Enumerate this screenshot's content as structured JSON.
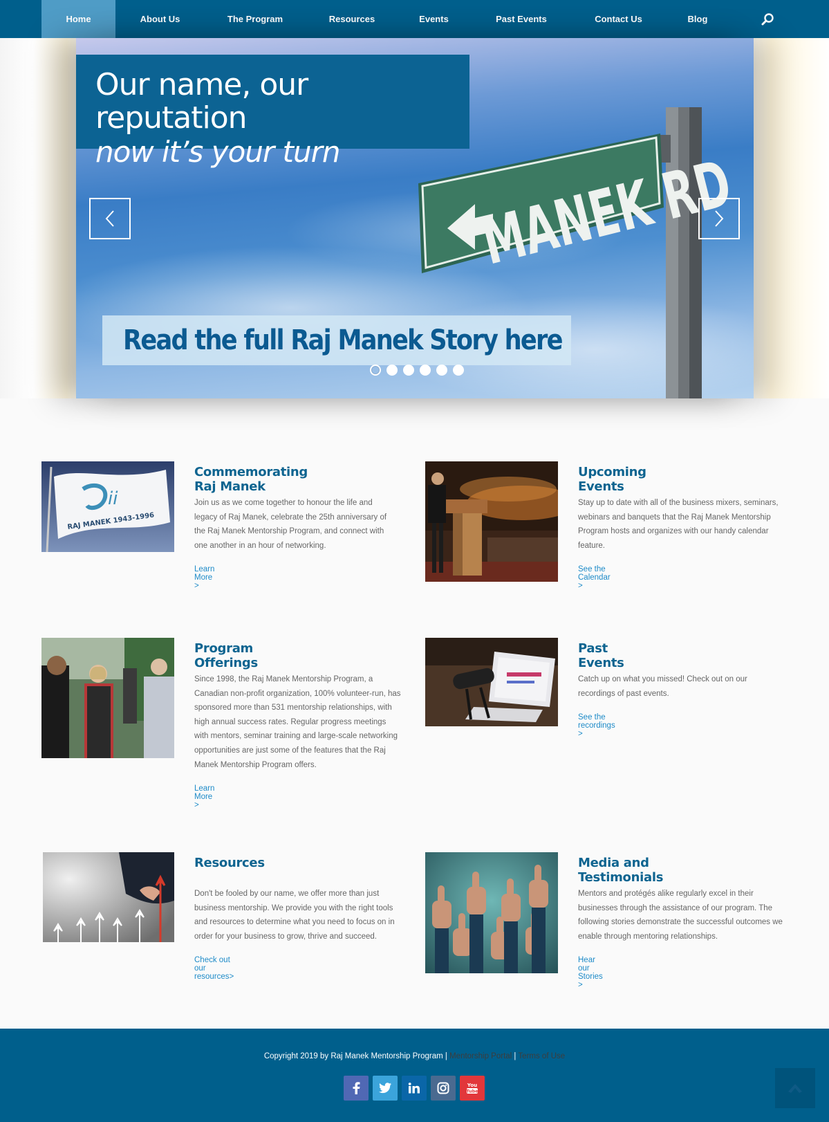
{
  "nav": {
    "items": [
      {
        "label": "Home",
        "active": true
      },
      {
        "label": "About Us"
      },
      {
        "label": "The Program"
      },
      {
        "label": "Resources"
      },
      {
        "label": "Events"
      },
      {
        "label": "Past Events"
      },
      {
        "label": "Contact Us"
      },
      {
        "label": "Blog"
      }
    ],
    "search_icon": "search-icon"
  },
  "hero": {
    "headline_1": "Our name, our reputation",
    "headline_2": "now it’s your turn",
    "sign_text": "MANEK RD",
    "cta": "Read the full Raj Manek Story here",
    "slides_total": 6,
    "active_slide": 1
  },
  "features": [
    {
      "title": "Commemorating Raj Manek",
      "body": "Join us as we come together to honour the life and legacy of Raj Manek, celebrate the 25th anniversary of the Raj Manek Mentorship Program, and connect with one another in an hour of networking.",
      "link": "Learn More >",
      "flag_text": "RAJ MANEK 1943-1996"
    },
    {
      "title": "Upcoming Events",
      "body": "Stay up to date with all of the business mixers, seminars, webinars and banquets that the Raj Manek Mentorship Program hosts and organizes with our handy calendar feature.",
      "link": "See the Calendar >"
    },
    {
      "title": "Program Offerings",
      "body": "Since 1998, the Raj Manek Mentorship Program, a Canadian non-profit organization, 100% volunteer-run, has sponsored more than 531 mentorship relationships, with high annual success rates. Regular progress meetings with mentors, seminar training and large-scale networking opportunities are just some of the features that the Raj Manek Mentorship Program offers.",
      "link": "Learn More >"
    },
    {
      "title": "Past Events",
      "body": "Catch up on what you missed! Check out on our recordings of past events.",
      "link": "See the recordings >"
    },
    {
      "title": "Resources",
      "body": "Don't be fooled by our name, we offer more than just business mentorship. We provide you with the right tools and resources to determine what you need to focus on in order for your business to grow, thrive and succeed.",
      "link": "Check out our resources>"
    },
    {
      "title": "Media and Testimonials",
      "body": "Mentors and protégés alike regularly excel in their businesses through the assistance of our program. The following stories demonstrate the successful outcomes we enable through mentoring relationships.",
      "link": "Hear our Stories >"
    }
  ],
  "footer": {
    "copyright": "Copyright 2019 by Raj Manek Mentorship Program",
    "separator": "|",
    "link_portal": "Mentorship Portal",
    "link_terms": "Terms of Use",
    "social": [
      {
        "icon": "facebook-icon",
        "label": "f",
        "color": "#5068b4"
      },
      {
        "icon": "twitter-icon",
        "label": "t",
        "color": "#3ba4db"
      },
      {
        "icon": "linkedin-icon",
        "label": "in",
        "color": "#0a66a8"
      },
      {
        "icon": "instagram-icon",
        "label": "ig",
        "color": "#4a6a90"
      },
      {
        "icon": "youtube-icon",
        "label": "You Tube",
        "color": "#e2373b"
      }
    ]
  },
  "colors": {
    "brand": "#005f8c",
    "nav_active": "#4f9cc6",
    "heading": "#0e6490",
    "link": "#1e8bc8"
  }
}
